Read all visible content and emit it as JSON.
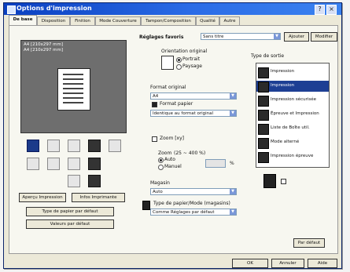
{
  "window": {
    "title": "Options d'impression",
    "controls": [
      "?",
      "×"
    ]
  },
  "tabs": [
    {
      "label": "De base",
      "active": true
    },
    {
      "label": "Disposition",
      "active": false
    },
    {
      "label": "Finition",
      "active": false
    },
    {
      "label": "Mode Couverture",
      "active": false
    },
    {
      "label": "Tampon/Composition",
      "active": false
    },
    {
      "label": "Qualité",
      "active": false
    },
    {
      "label": "Autre",
      "active": false
    }
  ],
  "preview": {
    "line1": "A4 [210x297 mm]",
    "line2": "A4 [210x297 mm]"
  },
  "left_buttons": {
    "config_button": "Aperçu Impression",
    "info_button": "Infos Imprimante",
    "type_button": "Type de papier par défaut",
    "restore_button": "Valeurs par défaut"
  },
  "top_row": {
    "profile_label": "Réglages favoris",
    "profile_value": "Sans titre",
    "add_button": "Ajouter",
    "modify_button": "Modifier"
  },
  "orientation": {
    "label": "Orientation original",
    "portrait": "Portrait",
    "landscape": "Paysage",
    "selected": "Portrait"
  },
  "format": {
    "label": "Format original",
    "value": "A4",
    "output_label": "Format papier",
    "output_value": "Identique au format original"
  },
  "zoom": {
    "checkbox_label": "Zoom [xy]",
    "label": "Zoom",
    "range": "(25 ~ 400 %)",
    "auto": "Auto",
    "manual": "Manuel",
    "selected": "Auto",
    "value": "",
    "unit": "%"
  },
  "tray": {
    "label": "Magasin",
    "value": "Auto",
    "paper_type_label": "Type de papier/Mode (magasins)",
    "paper_type_value": "Comme Réglages par défaut"
  },
  "output": {
    "label": "Type de sortie",
    "value": "Impression",
    "items": [
      {
        "label": "Impression",
        "selected": true
      },
      {
        "label": "Impression sécurisée",
        "selected": false
      },
      {
        "label": "Épreuve et Impression",
        "selected": false
      },
      {
        "label": "Liste de Boîte util.",
        "selected": false
      },
      {
        "label": "Mode alterné",
        "selected": false
      },
      {
        "label": "Impression épreuve",
        "selected": false
      }
    ]
  },
  "footer": {
    "settings_button": "Par défaut",
    "ok_button": "OK",
    "cancel_button": "Annuler",
    "help_button": "Aide"
  },
  "colors": {
    "title_start": "#0a3fc0",
    "title_end": "#3b82f0",
    "selected_row": "#1d3f94",
    "dialog_bg": "#ece9d8"
  }
}
